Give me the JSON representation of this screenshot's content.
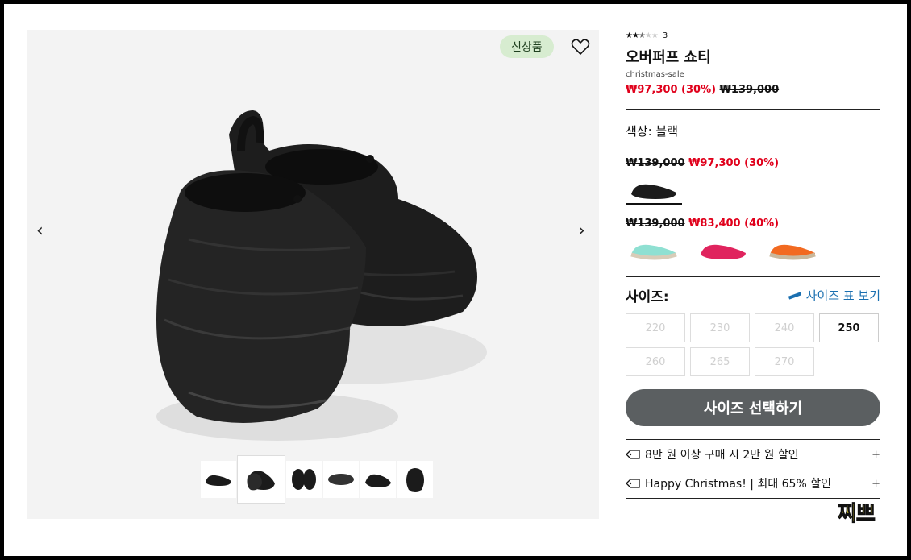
{
  "gallery": {
    "badge": "신상품",
    "icons": {
      "wishlist": "heart-icon",
      "prev": "chevron-left-icon",
      "next": "chevron-right-icon"
    },
    "nav_prev": "‹",
    "nav_next": "›",
    "thumbnail_count": 6,
    "active_thumbnail": 2
  },
  "product": {
    "rating_stars": "★★★★★",
    "rating_value": 2.5,
    "review_count": "3",
    "name": "오버퍼프 쇼티",
    "tag": "christmas-sale",
    "sale_price": "₩97,300 (30%)",
    "original_price": "₩139,000"
  },
  "color": {
    "label": "색상: 블랙",
    "groups": [
      {
        "original": "₩139,000",
        "sale": "₩97,300 (30%)",
        "swatches": [
          "black"
        ]
      },
      {
        "original": "₩139,000",
        "sale": "₩83,400 (40%)",
        "swatches": [
          "mint",
          "pink",
          "orange"
        ]
      }
    ],
    "swatch_colors": {
      "black": "#1c1c1c",
      "mint": "#8fe0d2",
      "pink": "#e0245e",
      "orange": "#f26a21"
    }
  },
  "size": {
    "label": "사이즈:",
    "guide": "사이즈 표 보기",
    "options": [
      "220",
      "230",
      "240",
      "250",
      "260",
      "265",
      "270"
    ],
    "available": [
      "250"
    ]
  },
  "cta": {
    "label": "사이즈 선택하기"
  },
  "promos": [
    {
      "text": "8만 원 이상 구매 시 2만 원 할인",
      "toggle": "+"
    },
    {
      "text": "Happy Christmas! | 최대 65% 할인",
      "toggle": "+"
    }
  ],
  "watermark": "찌쁘",
  "colors": {
    "sale": "#e0001b",
    "cta": "#5b5f61",
    "badge_bg": "#d7ecd0",
    "link": "#1a6fb0"
  }
}
